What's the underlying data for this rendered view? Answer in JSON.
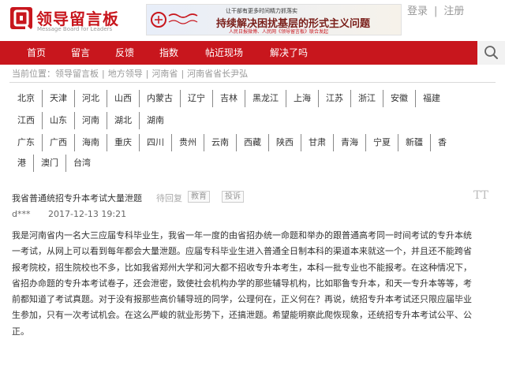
{
  "header": {
    "logo_text": "领导留言板",
    "logo_sub": "Message Board for Leaders",
    "banner": {
      "small": "让干部有更多时间精力抓落实",
      "big": "持续解决困扰基层的形式主义问题",
      "foot": "人民日报微博、人民网《领导留言板》联合发起"
    },
    "login_label": "登录",
    "separator": "|",
    "register_label": "注册"
  },
  "nav": {
    "items": [
      "首页",
      "留言",
      "反馈",
      "指数",
      "帖近现场",
      "解决了吗"
    ],
    "search_icon": "search-icon",
    "color": "#c8161d"
  },
  "breadcrumb": {
    "prefix": "当前位置：",
    "items": [
      "领导留言板",
      "地方领导",
      "河南省",
      "河南省省长尹弘"
    ],
    "sep": "|"
  },
  "provinces": {
    "row1": [
      "北京",
      "天津",
      "河北",
      "山西",
      "内蒙古",
      "辽宁",
      "吉林",
      "黑龙江",
      "上海",
      "江苏",
      "浙江",
      "安徽",
      "福建"
    ],
    "row2": [
      "江西",
      "山东",
      "河南",
      "湖北",
      "湖南"
    ],
    "row3": [
      "广东",
      "广西",
      "海南",
      "重庆",
      "四川",
      "贵州",
      "云南",
      "西藏",
      "陕西",
      "甘肃",
      "青海",
      "宁夏",
      "新疆",
      "香"
    ],
    "row4": [
      "港",
      "澳门",
      "台湾"
    ]
  },
  "message": {
    "title": "我省普通统招专升本考试大量泄题",
    "status": "待回复",
    "tags": [
      "教育",
      "投诉"
    ],
    "font_toggle": "TT",
    "author": "d***",
    "date": "2017-12-13 19:21",
    "body": "我是河南省内一名大三应届专科毕业生，我省一年一度的由省招办统一命题和举办的跟普通高考同一时间考试的专升本统一考试，从网上可以看到每年都会大量泄题。应届专科毕业生进入普通全日制本科的渠道本来就这一个，并且还不能跨省报考院校，招生院校也不多，比如我省郑州大学和河大都不招收专升本考生，本科一批专业也不能报考。在这种情况下，省招办命题的专升本考试卷子，还会泄密，致使社会机构办学的那些辅导机构，比如耶鲁专升本，和天一专升本等等，考前都知道了考试真题。对于没有报那些高价辅导班的同学，公理何在，正义何在？再说，统招专升本考试还只限应届毕业生参加，只有一次考试机会。在这么严峻的就业形势下，还搞泄题。希望能明察此爬恢现象，还统招专升本考试公平、公正。"
  }
}
